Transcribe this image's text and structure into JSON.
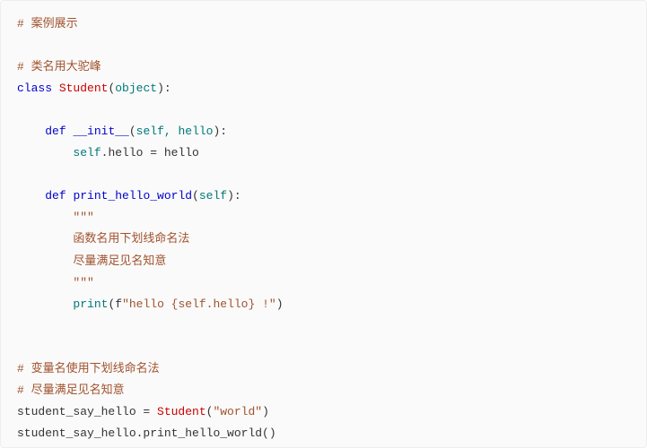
{
  "comments": {
    "title": "# 案例展示",
    "class_rule": "# 类名用大驼峰",
    "var_rule1": "# 变量名使用下划线命名法",
    "var_rule2": "# 尽量满足见名知意"
  },
  "cls": {
    "kw_class": "class",
    "name": "Student",
    "paren_open": "(",
    "base": "object",
    "paren_close_colon": "):"
  },
  "init": {
    "kw_def": "def",
    "name": "__init__",
    "paren_open": "(",
    "params": "self, hello",
    "paren_close_colon": "):",
    "body_self": "self",
    "body_dot_assign": ".hello = hello"
  },
  "method": {
    "kw_def": "def",
    "name": "print_hello_world",
    "paren_open": "(",
    "params": "self",
    "paren_close_colon": "):",
    "doc_open": "\"\"\"",
    "doc_line1": "函数名用下划线命名法",
    "doc_line2": "尽量满足见名知意",
    "doc_close": "\"\"\"",
    "print_call": "print",
    "print_open": "(",
    "fprefix": "f",
    "string": "\"hello {self.hello} !\"",
    "print_close": ")"
  },
  "usage": {
    "var": "student_say_hello",
    "eq": " = ",
    "ctor": "Student",
    "ctor_open": "(",
    "ctor_arg": "\"world\"",
    "ctor_close": ")",
    "call_obj": "student_say_hello",
    "call_dot_method": ".print_hello_world()"
  }
}
